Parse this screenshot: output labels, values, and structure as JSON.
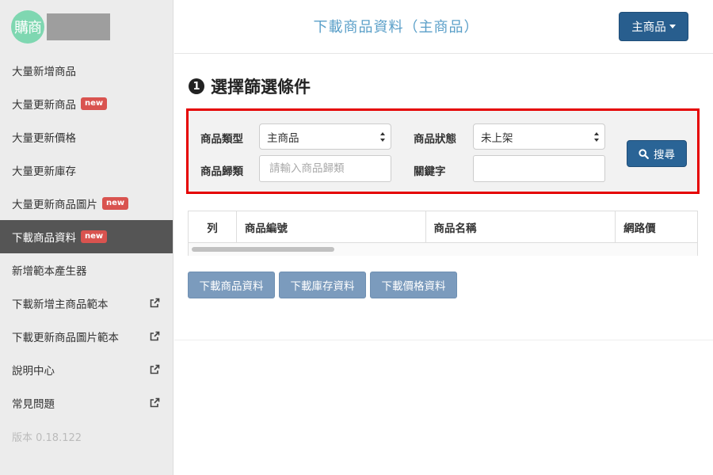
{
  "brand": {
    "logo_text": "購商"
  },
  "sidebar": {
    "items": [
      {
        "label": "大量新增商品"
      },
      {
        "label": "大量更新商品",
        "badge": "new"
      },
      {
        "label": "大量更新價格"
      },
      {
        "label": "大量更新庫存"
      },
      {
        "label": "大量更新商品圖片",
        "badge": "new"
      },
      {
        "label": "下載商品資料",
        "badge": "new",
        "active": true
      },
      {
        "label": "新增範本產生器"
      },
      {
        "label": "下載新增主商品範本",
        "icon": "external-link-icon"
      },
      {
        "label": "下載更新商品圖片範本",
        "icon": "external-link-icon"
      },
      {
        "label": "說明中心",
        "icon": "external-link-icon"
      },
      {
        "label": "常見問題",
        "icon": "external-link-icon"
      }
    ],
    "version": "版本 0.18.122"
  },
  "header": {
    "title": "下載商品資料（主商品）",
    "mode_button": "主商品"
  },
  "section": {
    "number": "1",
    "title": "選擇篩選條件"
  },
  "filters": {
    "type_label": "商品類型",
    "type_value": "主商品",
    "status_label": "商品狀態",
    "status_value": "未上架",
    "category_label": "商品歸類",
    "category_placeholder": "請輸入商品歸類",
    "keyword_label": "關鍵字",
    "keyword_value": "",
    "search_button": "搜尋"
  },
  "table": {
    "columns": [
      "列",
      "商品編號",
      "商品名稱",
      "網路價"
    ]
  },
  "actions": {
    "download_products": "下載商品資料",
    "download_stock": "下載庫存資料",
    "download_prices": "下載價格資料"
  },
  "colors": {
    "accent": "#285e8e",
    "highlight_border": "#e50000",
    "badge": "#d9534f",
    "title": "#5a9fc8"
  }
}
